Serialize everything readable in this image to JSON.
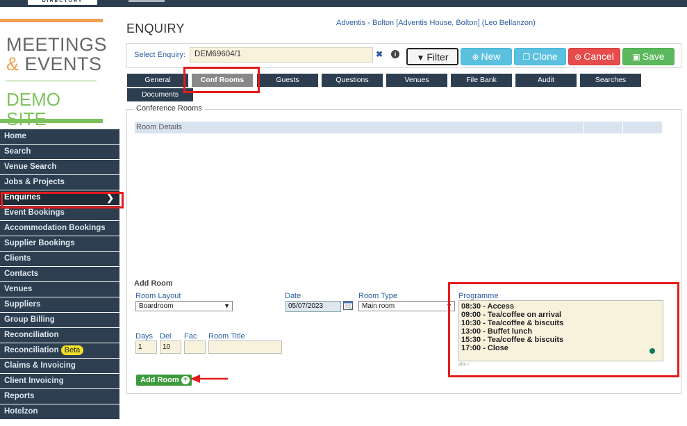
{
  "topbar": {
    "directory_label": "DIRECTORY"
  },
  "logo": {
    "line1": "MEETINGS",
    "amp": "&",
    "line2": "EVENTS",
    "demo": "DEMO SITE"
  },
  "sidebar": {
    "items": [
      {
        "label": "Home"
      },
      {
        "label": "Search"
      },
      {
        "label": "Venue Search"
      },
      {
        "label": "Jobs & Projects"
      },
      {
        "label": "Enquiries",
        "active": true
      },
      {
        "label": "Event Bookings"
      },
      {
        "label": "Accommodation Bookings"
      },
      {
        "label": "Supplier Bookings"
      },
      {
        "label": "Clients"
      },
      {
        "label": "Contacts"
      },
      {
        "label": "Venues"
      },
      {
        "label": "Suppliers"
      },
      {
        "label": "Group Billing"
      },
      {
        "label": "Reconciliation"
      },
      {
        "label": "Reconciliation",
        "badge": "Beta"
      },
      {
        "label": "Claims & Invoicing"
      },
      {
        "label": "Client Invoicing"
      },
      {
        "label": "Reports"
      },
      {
        "label": "Hotelzon"
      }
    ]
  },
  "page": {
    "title": "ENQUIRY",
    "header_info": "Adventis - Bolton [Adventis House, Bolton] (Leo Bellanzon)"
  },
  "select_enquiry": {
    "label": "Select Enquiry:",
    "value": "DEM69604/1"
  },
  "toolbar": {
    "filter": "Filter",
    "new": "New",
    "clone": "Clone",
    "cancel": "Cancel",
    "save": "Save"
  },
  "tabs": [
    {
      "label": "General"
    },
    {
      "label": "Conf Rooms",
      "active": true
    },
    {
      "label": "Guests"
    },
    {
      "label": "Questions"
    },
    {
      "label": "Venues"
    },
    {
      "label": "File Bank"
    },
    {
      "label": "Audit"
    },
    {
      "label": "Searches"
    },
    {
      "label": "Documents"
    }
  ],
  "conference_rooms": {
    "legend": "Conference Rooms",
    "table_header": "Room Details"
  },
  "add_room": {
    "title": "Add Room",
    "room_layout_label": "Room Layout",
    "room_layout_value": "Boardroom",
    "date_label": "Date",
    "date_value": "05/07/2023",
    "room_type_label": "Room Type",
    "room_type_value": "Main room",
    "programme_label": "Programme",
    "programme_lines": [
      "08:30 - Access",
      "09:00 - Tea/coffee on arrival",
      "10:30 - Tea/coffee & biscuits",
      "13:00 - Buffet lunch",
      "15:30 - Tea/coffee & biscuits",
      "17:00 - Close"
    ],
    "days_label": "Days",
    "days_value": "1",
    "del_label": "Del",
    "del_value": "10",
    "fac_label": "Fac",
    "fac_value": "",
    "room_title_label": "Room Title",
    "room_title_value": "",
    "add_button": "Add Room"
  },
  "colors": {
    "nav_bg": "#2c3e50",
    "highlight": "#e31b1b",
    "accent_orange": "#f0a050",
    "accent_green": "#7dc25c",
    "input_bg": "#f8f2dc"
  }
}
